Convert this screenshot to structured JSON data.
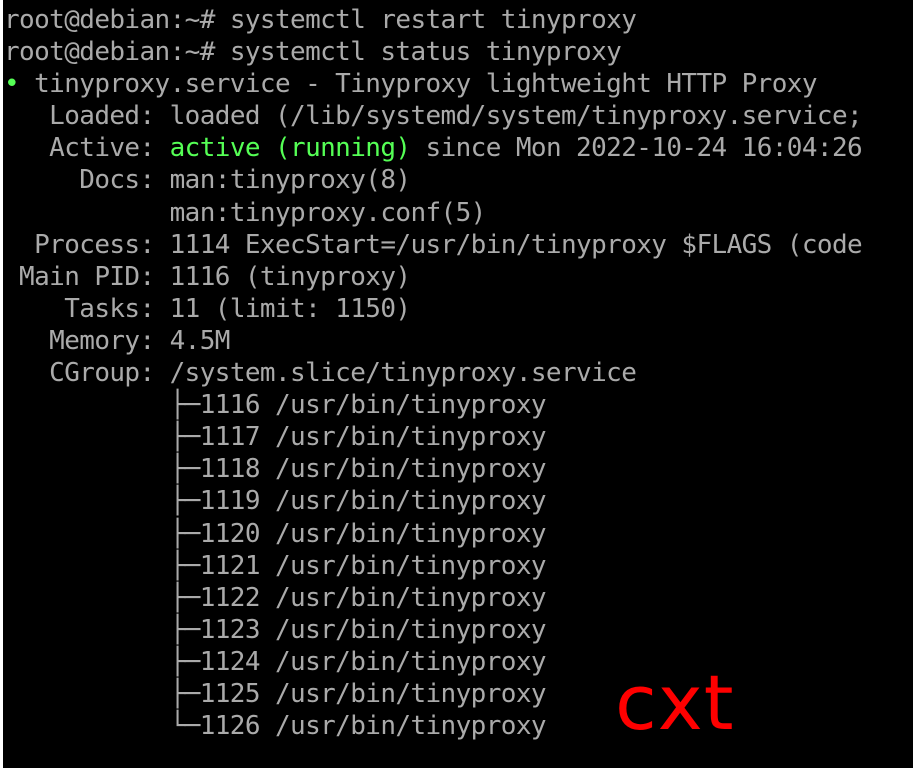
{
  "colors": {
    "background": "#000000",
    "text": "#aaaaaa",
    "status_green": "#55ff55",
    "watermark": "#ff0000"
  },
  "terminal": {
    "prompt": "root@debian:~# ",
    "commands": [
      "systemctl restart tinyproxy",
      "systemctl status tinyproxy"
    ],
    "status_dot": "•",
    "header": " tinyproxy.service - Tinyproxy lightweight HTTP Proxy",
    "loaded_label": "   Loaded:",
    "loaded_value": " loaded (/lib/systemd/system/tinyproxy.service;",
    "active_label": "   Active:",
    "active_state": " active (running)",
    "active_since": " since Mon 2022-10-24 16:04:26",
    "docs_label": "     Docs:",
    "docs_1": " man:tinyproxy(8)",
    "docs_2": "           man:tinyproxy.conf(5)",
    "process_label": "  Process:",
    "process_value": " 1114 ExecStart=/usr/bin/tinyproxy $FLAGS (code",
    "mainpid_label": " Main PID:",
    "mainpid_value": " 1116 (tinyproxy)",
    "tasks_label": "    Tasks:",
    "tasks_value": " 11 (limit: 1150)",
    "memory_label": "   Memory:",
    "memory_value": " 4.5M",
    "cgroup_label": "   CGroup:",
    "cgroup_value": " /system.slice/tinyproxy.service",
    "processes": [
      "           ├─1116 /usr/bin/tinyproxy",
      "           ├─1117 /usr/bin/tinyproxy",
      "           ├─1118 /usr/bin/tinyproxy",
      "           ├─1119 /usr/bin/tinyproxy",
      "           ├─1120 /usr/bin/tinyproxy",
      "           ├─1121 /usr/bin/tinyproxy",
      "           ├─1122 /usr/bin/tinyproxy",
      "           ├─1123 /usr/bin/tinyproxy",
      "           ├─1124 /usr/bin/tinyproxy",
      "           ├─1125 /usr/bin/tinyproxy",
      "           └─1126 /usr/bin/tinyproxy"
    ]
  },
  "watermark": "cxt"
}
